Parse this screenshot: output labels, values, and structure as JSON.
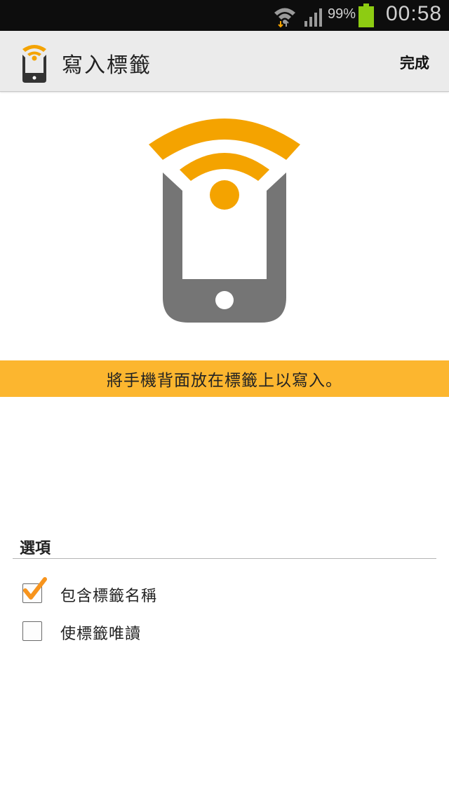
{
  "status_bar": {
    "battery_percent": "99%",
    "time": "00:58",
    "icons": [
      "wifi-icon",
      "signal-icon",
      "battery-icon"
    ],
    "battery_color": "#8dcc12"
  },
  "action_bar": {
    "title": "寫入標籤",
    "done_label": "完成",
    "app_icon": "nfc-phone-icon"
  },
  "hero": {
    "icon": "nfc-phone-icon",
    "accent_color": "#f4a300",
    "phone_color": "#757575"
  },
  "banner": {
    "text": "將手機背面放在標籤上以寫入。",
    "color": "#fcb62f"
  },
  "options": {
    "header": "選項",
    "items": [
      {
        "label": "包含標籤名稱",
        "checked": true
      },
      {
        "label": "使標籤唯讀",
        "checked": false
      }
    ],
    "check_color": "#f7941d"
  }
}
